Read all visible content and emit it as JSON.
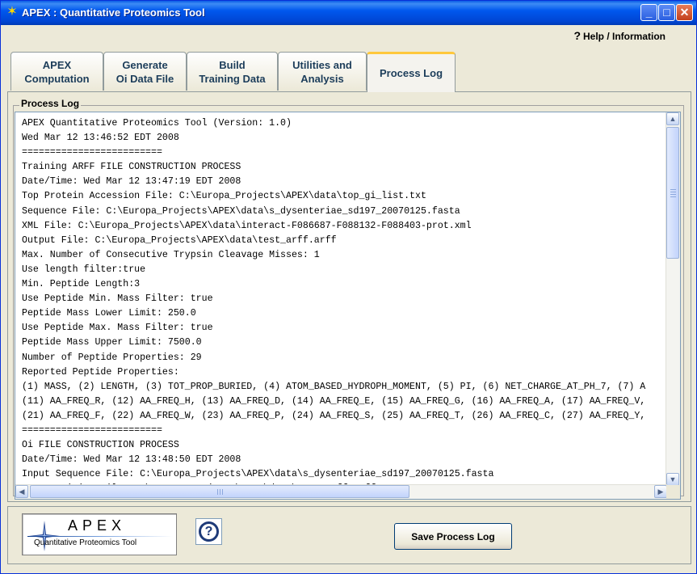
{
  "window": {
    "title": "APEX : Quantitative Proteomics Tool",
    "minimize": "_",
    "maximize": "□",
    "close": "✕"
  },
  "help": {
    "label": "Help / Information",
    "icon": "?"
  },
  "tabs": [
    {
      "line1": "APEX",
      "line2": "Computation"
    },
    {
      "line1": "Generate",
      "line2": "Oi Data File"
    },
    {
      "line1": "Build",
      "line2": "Training Data"
    },
    {
      "line1": "Utilities and",
      "line2": "Analysis"
    },
    {
      "line1": "Process Log",
      "line2": ""
    }
  ],
  "active_tab": "Process Log",
  "panel": {
    "legend": "Process Log"
  },
  "log_lines": [
    "APEX Quantitative Proteomics Tool (Version: 1.0)",
    "Wed Mar 12 13:46:52 EDT 2008",
    "=========================",
    "Training ARFF FILE CONSTRUCTION PROCESS",
    "Date/Time: Wed Mar 12 13:47:19 EDT 2008",
    "Top Protein Accession File: C:\\Europa_Projects\\APEX\\data\\top_gi_list.txt",
    "Sequence File: C:\\Europa_Projects\\APEX\\data\\s_dysenteriae_sd197_20070125.fasta",
    "XML File: C:\\Europa_Projects\\APEX\\data\\interact-F086687-F088132-F088403-prot.xml",
    "Output File: C:\\Europa_Projects\\APEX\\data\\test_arff.arff",
    "Max. Number of Consecutive Trypsin Cleavage Misses: 1",
    "Use length filter:true",
    "Min. Peptide Length:3",
    "Use Peptide Min. Mass Filter: true",
    "Peptide Mass Lower Limit: 250.0",
    "Use Peptide Max. Mass Filter: true",
    "Peptide Mass Upper Limit: 7500.0",
    "Number of Peptide Properties: 29",
    "Reported Peptide Properties:",
    "(1) MASS, (2) LENGTH, (3) TOT_PROP_BURIED, (4) ATOM_BASED_HYDROPH_MOMENT, (5) PI, (6) NET_CHARGE_AT_PH_7, (7) A",
    "(11) AA_FREQ_R, (12) AA_FREQ_H, (13) AA_FREQ_D, (14) AA_FREQ_E, (15) AA_FREQ_G, (16) AA_FREQ_A, (17) AA_FREQ_V,",
    "(21) AA_FREQ_F, (22) AA_FREQ_W, (23) AA_FREQ_P, (24) AA_FREQ_S, (25) AA_FREQ_T, (26) AA_FREQ_C, (27) AA_FREQ_Y,",
    "=========================",
    "Oi FILE CONSTRUCTION PROCESS",
    "Date/Time: Wed Mar 12 13:48:50 EDT 2008",
    "Input Sequence File: C:\\Europa_Projects\\APEX\\data\\s_dysenteriae_sd197_20070125.fasta",
    "ARFF Training File: C:\\Europa_Projects\\APEX\\data\\test_arff.arff"
  ],
  "footer": {
    "logo_title": "APEX",
    "logo_subtitle": "Quantitative Proteomics Tool",
    "help_icon": "?",
    "save_button": "Save Process Log"
  },
  "colors": {
    "titlebar": "#0058ee",
    "window_bg": "#ece9d8",
    "tab_text": "#1c3d5a",
    "active_tab_accent": "#ffc83c"
  }
}
